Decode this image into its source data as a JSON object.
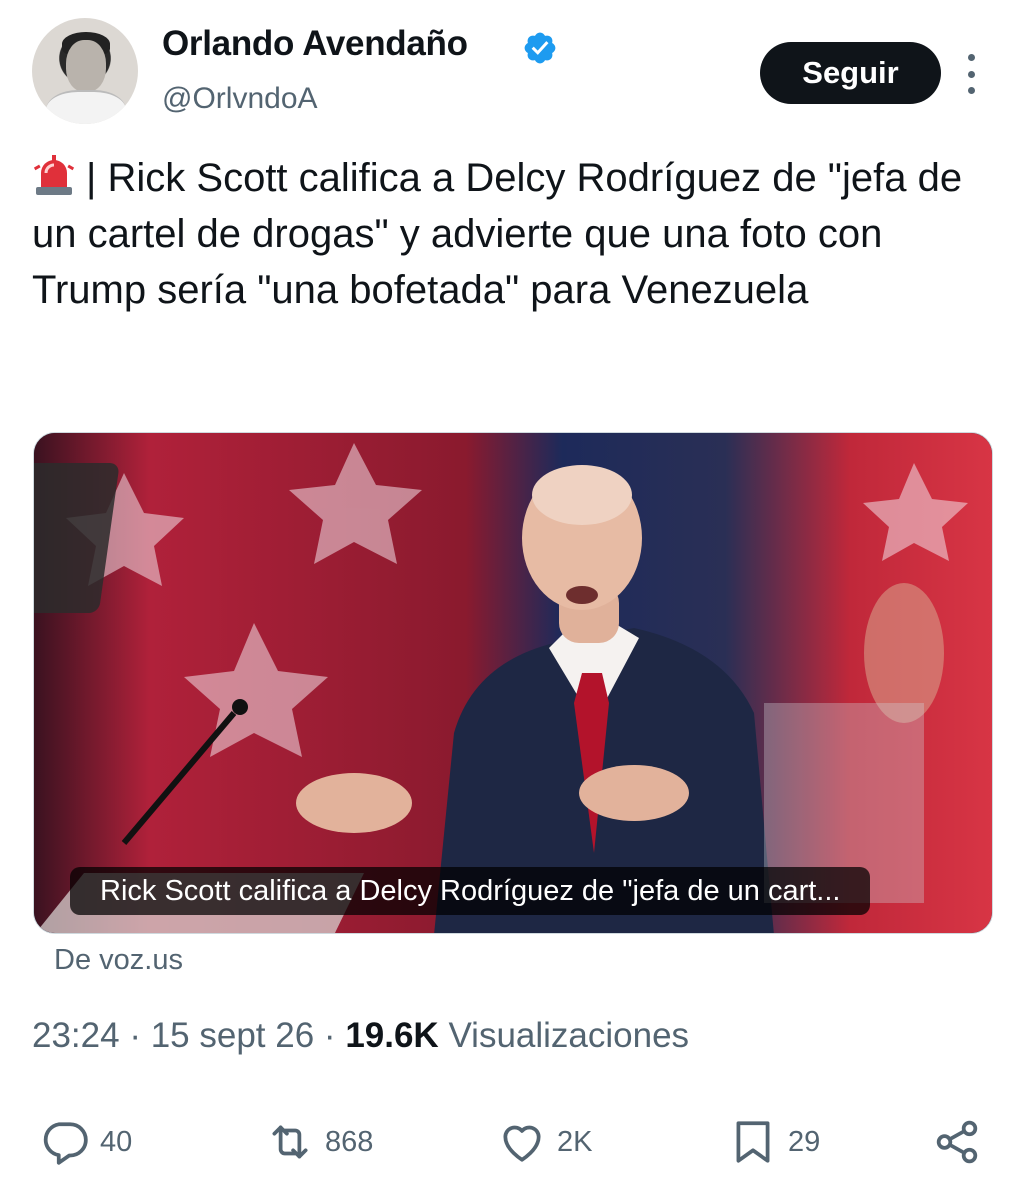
{
  "author": {
    "name": "Orlando Avendaño",
    "handle": "@OrlvndoA",
    "verified": true,
    "verified_color": "#1d9bf0"
  },
  "follow_button": {
    "label": "Seguir"
  },
  "tweet": {
    "text": "| Rick Scott califica a Delcy Rodríguez de \"jefa de un cartel de drogas\" y advierte que una foto con Trump sería \"una bofetada\" para Venezuela",
    "leading_emoji_icon": "siren-icon"
  },
  "link_card": {
    "caption": "Rick Scott califica a Delcy Rodríguez de \"jefa de un cart...",
    "source": "De voz.us"
  },
  "meta": {
    "time": "23:24",
    "separator": "·",
    "date": "15 sept 26",
    "views_count": "19.6K",
    "views_label": "Visualizaciones"
  },
  "actions": {
    "replies": "40",
    "reposts": "868",
    "likes": "2K",
    "bookmarks": "29"
  },
  "colors": {
    "text": "#0f1419",
    "secondary": "#536471",
    "button_bg": "#0f1419",
    "accent_red": "#c8102e"
  }
}
